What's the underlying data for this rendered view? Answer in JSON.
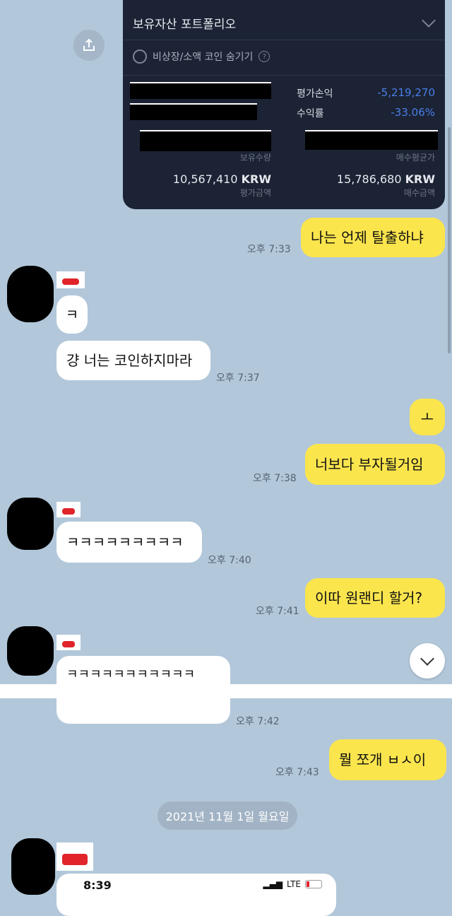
{
  "portfolio": {
    "title": "보유자산 포트폴리오",
    "hide_label": "비상장/소액 코인 숨기기",
    "help": "?",
    "eval_pl_label": "평가손익",
    "eval_pl_value": "-5,219,270",
    "return_label": "수익률",
    "return_value": "-33.06%",
    "holdings_label": "보유수량",
    "avg_buy_label": "매수평균가",
    "eval_amount_value": "10,567,410",
    "eval_amount_unit": "KRW",
    "eval_amount_label": "평가금액",
    "buy_amount_value": "15,786,680",
    "buy_amount_unit": "KRW",
    "buy_amount_label": "매수금액"
  },
  "messages": [
    {
      "text": "나는 언제 탈출하냐",
      "time": "오후 7:33"
    },
    {
      "text": "ㅋ"
    },
    {
      "text": "걍 너는 코인하지마라",
      "time": "오후 7:37"
    },
    {
      "text": "ㅗ"
    },
    {
      "text": "너보다 부자될거임",
      "time": "오후 7:38"
    },
    {
      "text": "ㅋㅋㅋㅋㅋㅋㅋㅋㅋ",
      "time": "오후 7:40"
    },
    {
      "text": "이따 원랜디 할거?",
      "time": "오후 7:41"
    },
    {
      "text": "ㅋㅋㅋㅋㅋㅋㅋㅋㅋㅋㅋ",
      "time": "오후 7:42"
    },
    {
      "text": "뭘 쪼개 ㅂㅅ이",
      "time": "오후 7:43"
    }
  ],
  "date_separator": "2021년 11월 1일 월요일",
  "embedded_screenshot": {
    "time": "8:39",
    "network": "LTE"
  },
  "colors": {
    "chat_bg": "#b2c7da",
    "my_bubble": "#fbe54d",
    "their_bubble": "#ffffff",
    "negative": "#4a7fe8"
  }
}
